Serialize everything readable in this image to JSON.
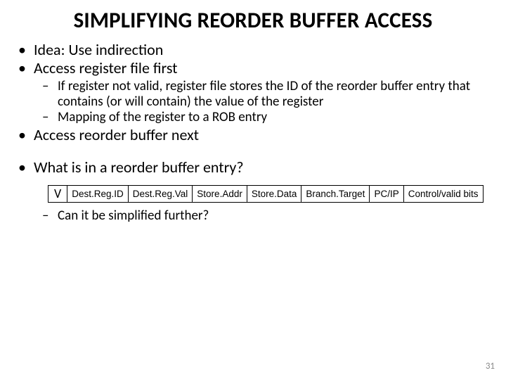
{
  "slide": {
    "title": "SIMPLIFYING REORDER BUFFER ACCESS",
    "bullets": {
      "b1": "Idea: Use indirection",
      "b2": "Access register file first",
      "b2_sub1": "If register not valid, register file stores the ID of the reorder buffer entry that contains (or will contain) the value of the register",
      "b2_sub2": "Mapping of the register to a ROB entry",
      "b3": "Access reorder buffer next",
      "b4": "What is in a reorder buffer entry?",
      "b4_sub1": "Can it be simplified further?"
    },
    "rob_entry": {
      "c0": "V",
      "c1": "Dest.Reg.ID",
      "c2": "Dest.Reg.Val",
      "c3": "Store.Addr",
      "c4": "Store.Data",
      "c5": "Branch.Target",
      "c6": "PC/IP",
      "c7": "Control/valid bits"
    },
    "page_number": "31"
  }
}
